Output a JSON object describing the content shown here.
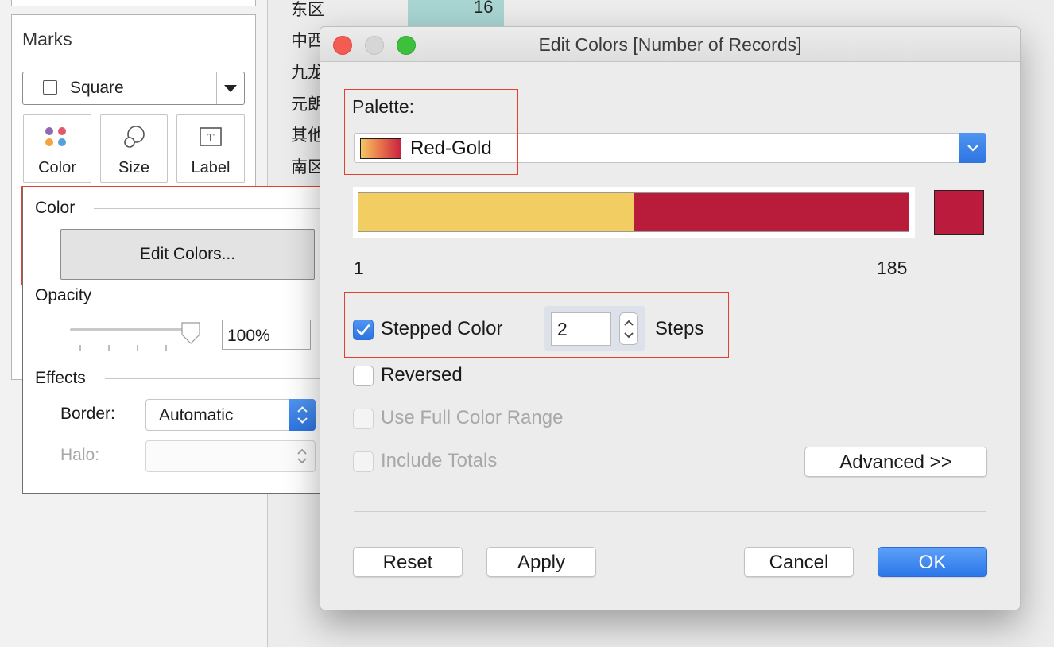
{
  "background": {
    "rows": [
      "东区",
      "中西",
      "九龙",
      "元朗",
      "其他",
      "南区"
    ],
    "top_cell_value": "16"
  },
  "marks_panel": {
    "title": "Marks",
    "mark_type": "Square",
    "buttons": [
      {
        "label": "Color",
        "icon": "color-dots-icon"
      },
      {
        "label": "Size",
        "icon": "size-circles-icon"
      },
      {
        "label": "Label",
        "icon": "text-label-icon"
      }
    ],
    "color_section": {
      "heading": "Color",
      "edit_colors_button": "Edit Colors...",
      "opacity_heading": "Opacity",
      "opacity_value": "100%",
      "opacity_fraction": 1.0,
      "effects_heading": "Effects",
      "border_label": "Border:",
      "border_value": "Automatic",
      "halo_label": "Halo:"
    }
  },
  "dialog": {
    "title": "Edit Colors [Number of Records]",
    "palette_label": "Palette:",
    "palette_value": "Red-Gold",
    "gradient_colors": [
      "#f4c765",
      "#ea7a4c",
      "#c9243e"
    ],
    "step_colors": [
      "#f2cd62",
      "#b91c3b"
    ],
    "end_color": "#bb1c3d",
    "range_min": "1",
    "range_max": "185",
    "stepped_color": {
      "label": "Stepped Color",
      "checked": true,
      "steps_value": "2",
      "steps_label": "Steps"
    },
    "options": [
      {
        "key": "reversed",
        "label": "Reversed",
        "checked": false,
        "enabled": true
      },
      {
        "key": "full_range",
        "label": "Use Full Color Range",
        "checked": false,
        "enabled": false
      },
      {
        "key": "include_totals",
        "label": "Include Totals",
        "checked": false,
        "enabled": false
      }
    ],
    "advanced_button": "Advanced >>",
    "buttons": {
      "reset": "Reset",
      "apply": "Apply",
      "cancel": "Cancel",
      "ok": "OK"
    }
  }
}
